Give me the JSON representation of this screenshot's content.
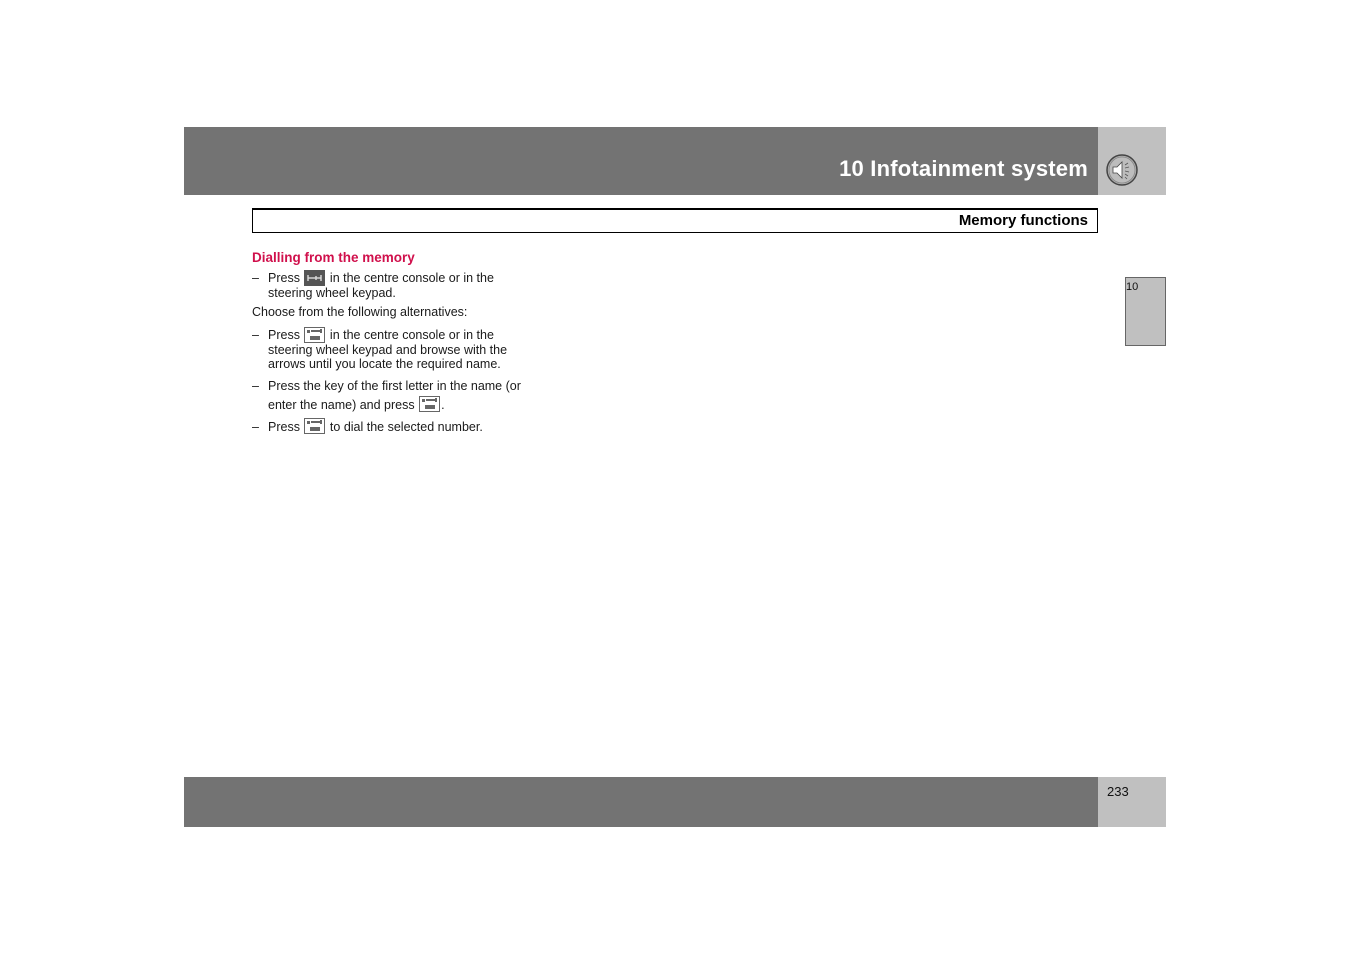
{
  "header": {
    "chapter_title": "10 Infotainment system",
    "chapter_icon": "speaker-icon"
  },
  "subheader": {
    "section_title": "Memory functions"
  },
  "content": {
    "heading": "Dialling from the memory",
    "step1": {
      "dash": "–",
      "before": "Press",
      "icon": "phone-memory-button-icon",
      "after": "in the centre console or in the steering wheel keypad."
    },
    "intro": "Choose from the following alternatives:",
    "alt1": {
      "dash": "–",
      "before": "Press",
      "icon": "yes-button-icon",
      "after": "in the centre console or in the steering wheel keypad and browse with the arrows until you locate the required name."
    },
    "alt2": {
      "dash": "–",
      "before": "Press the key of the first letter in the name (or enter the name) and press",
      "icon": "yes-button-icon",
      "after": "."
    },
    "alt3": {
      "dash": "–",
      "before": "Press",
      "icon": "yes-button-icon",
      "after": "to dial the selected number."
    }
  },
  "side_tab": {
    "label": "10"
  },
  "footer": {
    "page_number": "233"
  }
}
